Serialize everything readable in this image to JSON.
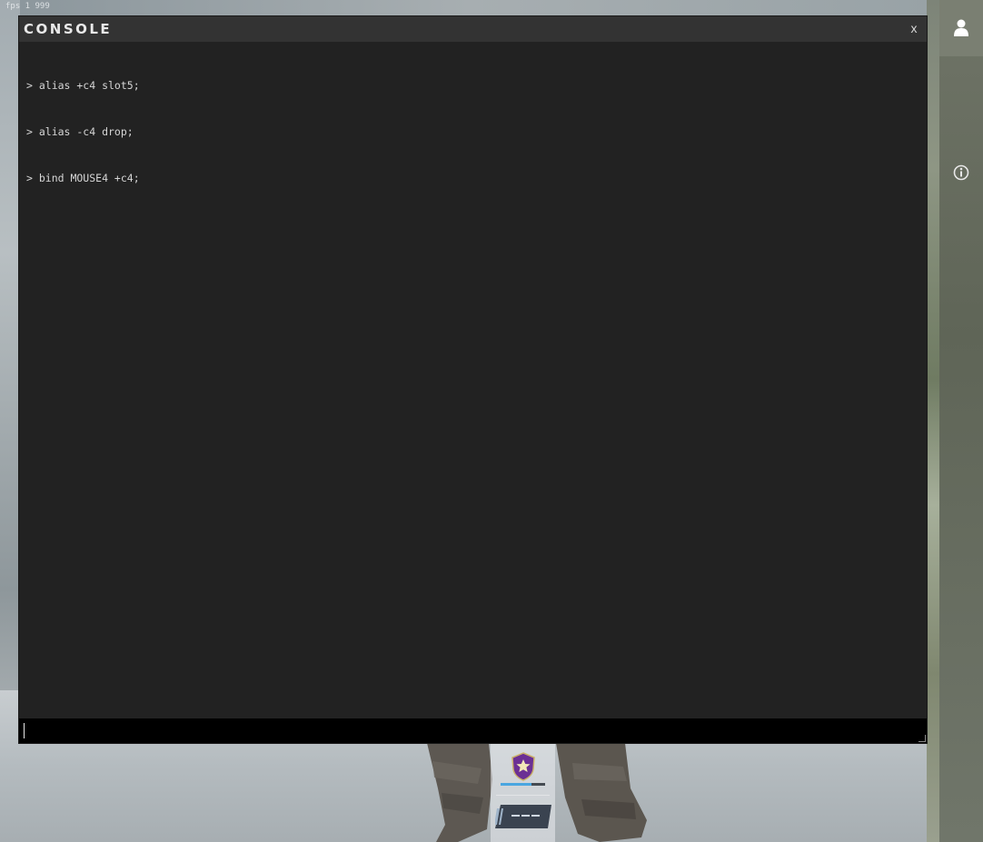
{
  "overlay": {
    "fps_text": "fps 1 999"
  },
  "console": {
    "title": "CONSOLE",
    "close_label": "x",
    "lines": [
      "> alias +c4 slot5;",
      "> alias -c4 drop;",
      "> bind MOUSE4 +c4;"
    ],
    "input_value": "",
    "input_placeholder": ""
  },
  "sidebar": {
    "profile_icon": "person-icon",
    "info_icon": "info-icon"
  },
  "rank": {
    "badge_icon": "rank-shield-star-icon",
    "progress_fraction": 0.7,
    "plate_icon": "rating-plate-icon"
  },
  "colors": {
    "console_bg": "#222222",
    "console_titlebar": "#333333",
    "console_input_bg": "#000000",
    "rank_progress": "#4aa6e0",
    "rank_badge": "#7b3fa8"
  }
}
